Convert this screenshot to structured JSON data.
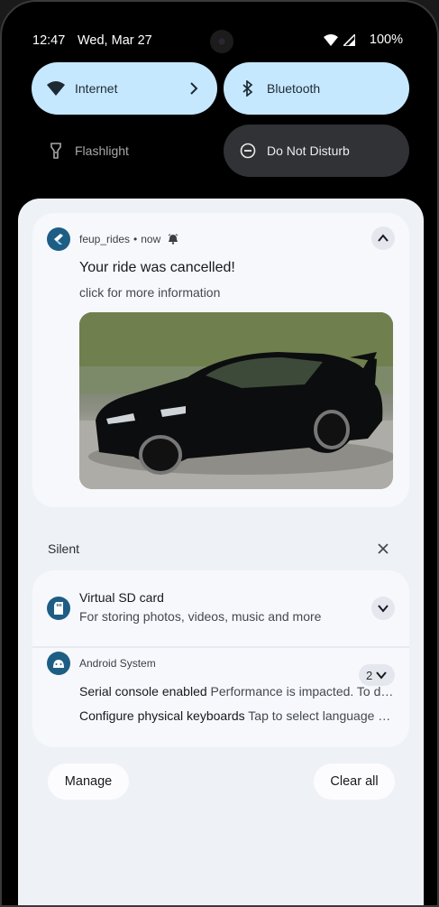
{
  "status_bar": {
    "time": "12:47",
    "date": "Wed, Mar 27",
    "battery": "100%",
    "icons": [
      "wifi-icon",
      "cell-signal-icon"
    ]
  },
  "quick_settings": {
    "internet": {
      "label": "Internet",
      "state": "on",
      "icon": "wifi-icon"
    },
    "bluetooth": {
      "label": "Bluetooth",
      "state": "on",
      "icon": "bluetooth-icon"
    },
    "flashlight": {
      "label": "Flashlight",
      "state": "off",
      "icon": "flashlight-icon"
    },
    "dnd": {
      "label": "Do Not Disturb",
      "state": "off",
      "icon": "minus-circle-icon"
    }
  },
  "notification": {
    "app_name": "feup_rides",
    "separator": "•",
    "time": "now",
    "title": "Your ride was cancelled!",
    "body": "click for more information",
    "image": "black sports car photo"
  },
  "silent_section": {
    "label": "Silent"
  },
  "silent_notifications": {
    "sd_card": {
      "title": "Virtual SD card",
      "subtitle": "For storing photos, videos, music and more"
    },
    "android_system": {
      "app_name": "Android System",
      "count": "2",
      "line1_title": "Serial console enabled",
      "line1_text": "Performance is impacted. To di…",
      "line2_title": "Configure physical keyboards",
      "line2_text": "Tap to select language a…"
    }
  },
  "actions": {
    "manage": "Manage",
    "clear_all": "Clear all"
  },
  "colors": {
    "tile_on": "#c5e8ff",
    "tile_dark": "#303235",
    "shade_bg": "#eef1f6",
    "app_icon": "#1e5d84"
  }
}
